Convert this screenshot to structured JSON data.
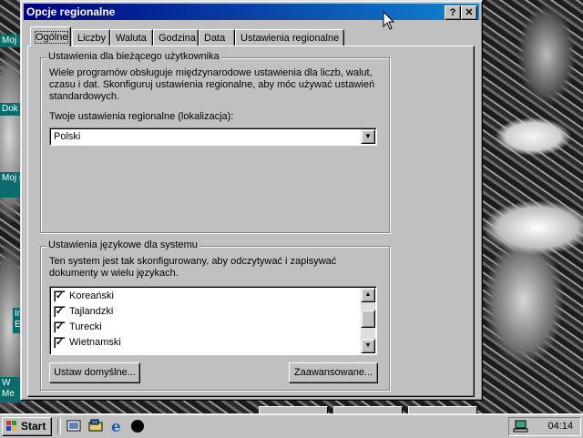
{
  "window": {
    "title": "Opcje regionalne",
    "help_button": "?",
    "close_button": "✕"
  },
  "tabs": [
    {
      "label": "Ogólne"
    },
    {
      "label": "Liczby"
    },
    {
      "label": "Waluta"
    },
    {
      "label": "Godzina"
    },
    {
      "label": "Data"
    },
    {
      "label": "Ustawienia regionalne"
    }
  ],
  "current_user": {
    "group_title": "Ustawienia dla bieżącego użytkownika",
    "description_lines": [
      "Wiele programów obsługuje międzynarodowe ustawienia dla liczb, walut,",
      "czasu i dat. Skonfiguruj ustawienia regionalne, aby móc używać ustawień",
      "standardowych."
    ],
    "locale_label": "Twoje ustawienia regionalne (lokalizacja):",
    "locale_value": "Polski"
  },
  "system_languages": {
    "group_title": "Ustawienia językowe dla systemu",
    "description_lines": [
      "Ten system jest tak skonfigurowany, aby odczytywać i zapisywać",
      "dokumenty w wielu językach."
    ],
    "items": [
      {
        "label": "Koreański",
        "checked": "✓"
      },
      {
        "label": "Tajlandzki",
        "checked": "✓"
      },
      {
        "label": "Turecki",
        "checked": "✓"
      },
      {
        "label": "Wietnamski",
        "checked": "✓"
      }
    ],
    "set_default_button": "Ustaw domyślne...",
    "advanced_button": "Zaawansowane..."
  },
  "desktop_icons": [
    {
      "label": "Moj"
    },
    {
      "label": "Dok"
    },
    {
      "label": "Moj s"
    },
    {
      "label": "In E"
    },
    {
      "label": "W Me"
    }
  ],
  "taskbar": {
    "start_label": "Start",
    "clock": "04:14"
  },
  "colors": {
    "titlebar_start": "#000080",
    "titlebar_end": "#1084d0",
    "face": "#c0c0c0"
  }
}
